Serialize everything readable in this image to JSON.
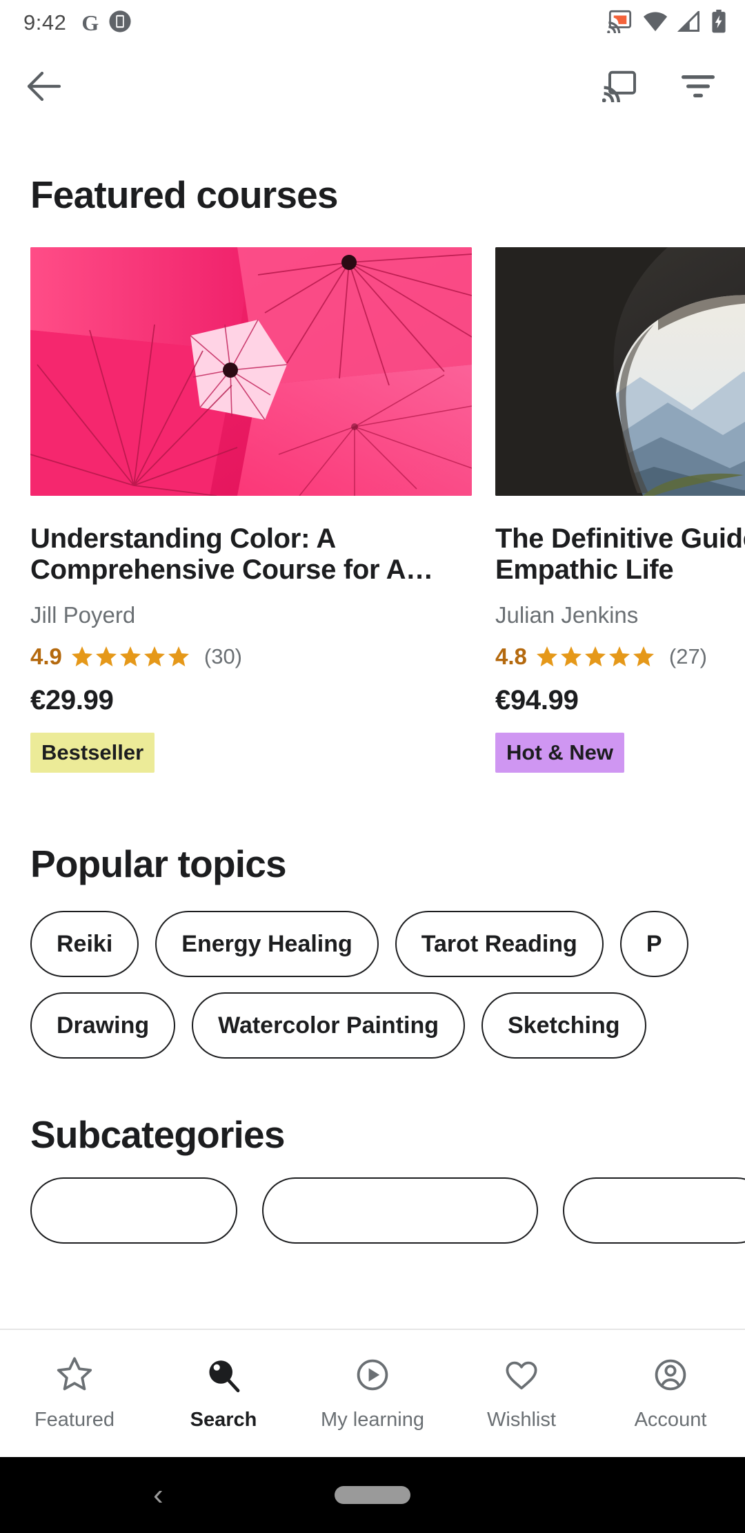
{
  "statusbar": {
    "time": "9:42",
    "icons": [
      "google-g-icon",
      "screenshot-icon",
      "cast-icon",
      "wifi-icon",
      "cellular-icon",
      "battery-charging-icon"
    ]
  },
  "appbar": {
    "back_label": "back-arrow",
    "cast_label": "cast",
    "filter_label": "filter"
  },
  "featured": {
    "title": "Featured courses",
    "courses": [
      {
        "title": "Understanding Color: A\nComprehensive Course for A…",
        "author": "Jill Poyerd",
        "rating": "4.9",
        "stars": 5,
        "reviews": "(30)",
        "price": "€29.99",
        "badge": "Bestseller",
        "badge_color": "#eceb98",
        "image": "pink-umbrellas-photo"
      },
      {
        "title": "The Definitive Guide to an\nEmpathic Life",
        "author": "Julian Jenkins",
        "rating": "4.8",
        "stars": 5,
        "reviews": "(27)",
        "price": "€94.99",
        "badge": "Hot & New",
        "badge_color": "#cf96f2",
        "image": "cave-mountain-view-photo"
      }
    ]
  },
  "topics": {
    "title": "Popular topics",
    "row1": [
      "Reiki",
      "Energy Healing",
      "Tarot Reading",
      "P"
    ],
    "row2": [
      "Drawing",
      "Watercolor Painting",
      "Sketching"
    ]
  },
  "subcategories": {
    "title": "Subcategories",
    "items": [
      "",
      "",
      ""
    ]
  },
  "bottomnav": {
    "items": [
      {
        "label": "Featured",
        "icon": "star-icon",
        "active": false
      },
      {
        "label": "Search",
        "icon": "search-icon",
        "active": true
      },
      {
        "label": "My learning",
        "icon": "play-circle-icon",
        "active": false
      },
      {
        "label": "Wishlist",
        "icon": "heart-icon",
        "active": false
      },
      {
        "label": "Account",
        "icon": "account-circle-icon",
        "active": false
      }
    ]
  },
  "sysnav": {
    "back": "‹",
    "pill": "home-pill"
  },
  "colors": {
    "accent_star": "#e59819",
    "rating_text": "#b4690e",
    "text_primary": "#1c1d1f",
    "text_secondary": "#6a6f73",
    "cast_orange": "#f4623a"
  }
}
